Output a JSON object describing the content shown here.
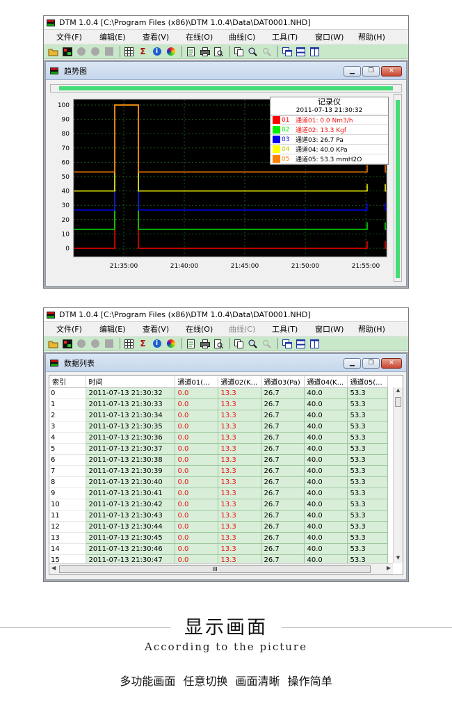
{
  "app": {
    "title": "DTM 1.0.4 [C:\\Program Files (x86)\\DTM 1.0.4\\Data\\DAT0001.NHD]",
    "menu": [
      "文件(F)",
      "编辑(E)",
      "查看(V)",
      "在线(O)",
      "曲线(C)",
      "工具(T)",
      "窗口(W)",
      "帮助(H)"
    ]
  },
  "toolbar_icons": [
    "open-folder-icon",
    "acquire-icon",
    "record-off-icon",
    "pause-off-icon",
    "stop-off-icon",
    "grid-table-icon",
    "sigma-icon",
    "info-icon",
    "color-wheel-icon",
    "document-icon",
    "print-icon",
    "print-preview-icon",
    "copy-icon",
    "zoom-icon",
    "clear-zoom-icon",
    "cascade-windows-icon",
    "tile-horizontal-icon",
    "tile-vertical-icon"
  ],
  "trend": {
    "window_title": "趋势图",
    "legend_title": "记录仪",
    "legend_time": "2011-07-13 21:30:32",
    "channels": [
      {
        "num": "01",
        "label": "通道01: 0.0 Nm3/h",
        "color": "#ff0000",
        "text_color": "#ee1111"
      },
      {
        "num": "02",
        "label": "通道02: 13.3 Kgf",
        "color": "#00ee00",
        "text_color": "#ee1111"
      },
      {
        "num": "03",
        "label": "通道03: 26.7 Pa",
        "color": "#0000ee",
        "text_color": "#000000"
      },
      {
        "num": "04",
        "label": "通道04: 40.0 KPa",
        "color": "#ffff00",
        "text_color": "#000000"
      },
      {
        "num": "05",
        "label": "通道05: 53.3 mmH2O",
        "color": "#ff7f00",
        "text_color": "#000000"
      }
    ]
  },
  "chart_data": {
    "type": "line",
    "title": "",
    "xlabel": "",
    "ylabel": "",
    "x_ticks": [
      "21:35:00",
      "21:40:00",
      "21:45:00",
      "21:50:00",
      "21:55:00"
    ],
    "y_ticks": [
      0,
      10,
      20,
      30,
      40,
      50,
      60,
      70,
      80,
      90,
      100
    ],
    "ylim": [
      0,
      100
    ],
    "grid": true,
    "background": "#000000",
    "series": [
      {
        "name": "通道01",
        "color": "#ff0000",
        "baseline": 0.0,
        "spikes": [
          [
            21.5,
            100.0
          ]
        ]
      },
      {
        "name": "通道02",
        "color": "#00ee00",
        "baseline": 13.3,
        "spikes": [
          [
            21.5,
            100.0
          ]
        ]
      },
      {
        "name": "通道03",
        "color": "#0000ee",
        "baseline": 26.7,
        "spikes": [
          [
            21.5,
            100.0
          ]
        ]
      },
      {
        "name": "通道04",
        "color": "#ffff00",
        "baseline": 40.0,
        "spikes": [
          [
            21.5,
            100.0
          ]
        ]
      },
      {
        "name": "通道05",
        "color": "#ff7f00",
        "baseline": 53.3,
        "spikes": [
          [
            21.5,
            100.0
          ]
        ]
      }
    ]
  },
  "table": {
    "window_title": "数据列表",
    "columns": [
      "索引",
      "时间",
      "通道01(...",
      "通道02(K...",
      "通道03(Pa)",
      "通道04(K...",
      "通道05(..."
    ],
    "rows": [
      [
        "0",
        "2011-07-13 21:30:32",
        "0.0",
        "13.3",
        "26.7",
        "40.0",
        "53.3"
      ],
      [
        "1",
        "2011-07-13 21:30:33",
        "0.0",
        "13.3",
        "26.7",
        "40.0",
        "53.3"
      ],
      [
        "2",
        "2011-07-13 21:30:34",
        "0.0",
        "13.3",
        "26.7",
        "40.0",
        "53.3"
      ],
      [
        "3",
        "2011-07-13 21:30:35",
        "0.0",
        "13.3",
        "26.7",
        "40.0",
        "53.3"
      ],
      [
        "4",
        "2011-07-13 21:30:36",
        "0.0",
        "13.3",
        "26.7",
        "40.0",
        "53.3"
      ],
      [
        "5",
        "2011-07-13 21:30:37",
        "0.0",
        "13.3",
        "26.7",
        "40.0",
        "53.3"
      ],
      [
        "6",
        "2011-07-13 21:30:38",
        "0.0",
        "13.3",
        "26.7",
        "40.0",
        "53.3"
      ],
      [
        "7",
        "2011-07-13 21:30:39",
        "0.0",
        "13.3",
        "26.7",
        "40.0",
        "53.3"
      ],
      [
        "8",
        "2011-07-13 21:30:40",
        "0.0",
        "13.3",
        "26.7",
        "40.0",
        "53.3"
      ],
      [
        "9",
        "2011-07-13 21:30:41",
        "0.0",
        "13.3",
        "26.7",
        "40.0",
        "53.3"
      ],
      [
        "10",
        "2011-07-13 21:30:42",
        "0.0",
        "13.3",
        "26.7",
        "40.0",
        "53.3"
      ],
      [
        "11",
        "2011-07-13 21:30:43",
        "0.0",
        "13.3",
        "26.7",
        "40.0",
        "53.3"
      ],
      [
        "12",
        "2011-07-13 21:30:44",
        "0.0",
        "13.3",
        "26.7",
        "40.0",
        "53.3"
      ],
      [
        "13",
        "2011-07-13 21:30:45",
        "0.0",
        "13.3",
        "26.7",
        "40.0",
        "53.3"
      ],
      [
        "14",
        "2011-07-13 21:30:46",
        "0.0",
        "13.3",
        "26.7",
        "40.0",
        "53.3"
      ],
      [
        "15",
        "2011-07-13 21:30:47",
        "0.0",
        "13.3",
        "26.7",
        "40.0",
        "53.3"
      ]
    ],
    "hscroll_thumb": "III"
  },
  "caption": {
    "main": "显示画面",
    "sub": "According to the picture",
    "features": [
      "多功能画面",
      "任意切换",
      "画面清晰",
      "操作简单"
    ]
  }
}
